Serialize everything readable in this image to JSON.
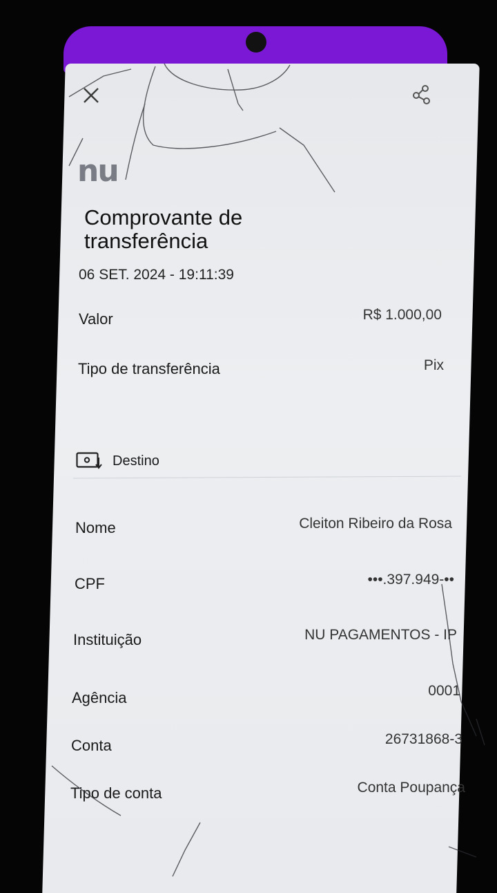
{
  "header": {
    "close_icon": "close-icon",
    "share_icon": "share-icon",
    "logo_text": "nu"
  },
  "receipt": {
    "title": "Comprovante de transferência",
    "datetime": "06 SET. 2024 - 19:11:39",
    "summary": [
      {
        "label": "Valor",
        "value": "R$ 1.000,00"
      },
      {
        "label": "Tipo de transferência",
        "value": "Pix"
      }
    ],
    "destination": {
      "section_label": "Destino",
      "section_icon": "account-transfer-icon",
      "rows": [
        {
          "label": "Nome",
          "value": "Cleiton Ribeiro da Rosa"
        },
        {
          "label": "CPF",
          "value": "•••.397.949-••"
        },
        {
          "label": "Instituição",
          "value": "NU PAGAMENTOS - IP"
        },
        {
          "label": "Agência",
          "value": "0001"
        },
        {
          "label": "Conta",
          "value": "26731868-3"
        },
        {
          "label": "Tipo de conta",
          "value": "Conta Poupança"
        }
      ]
    }
  },
  "colors": {
    "brand_purple": "#7a18d6",
    "screen_bg": "#e8eaed",
    "text": "#1a1a1a"
  }
}
